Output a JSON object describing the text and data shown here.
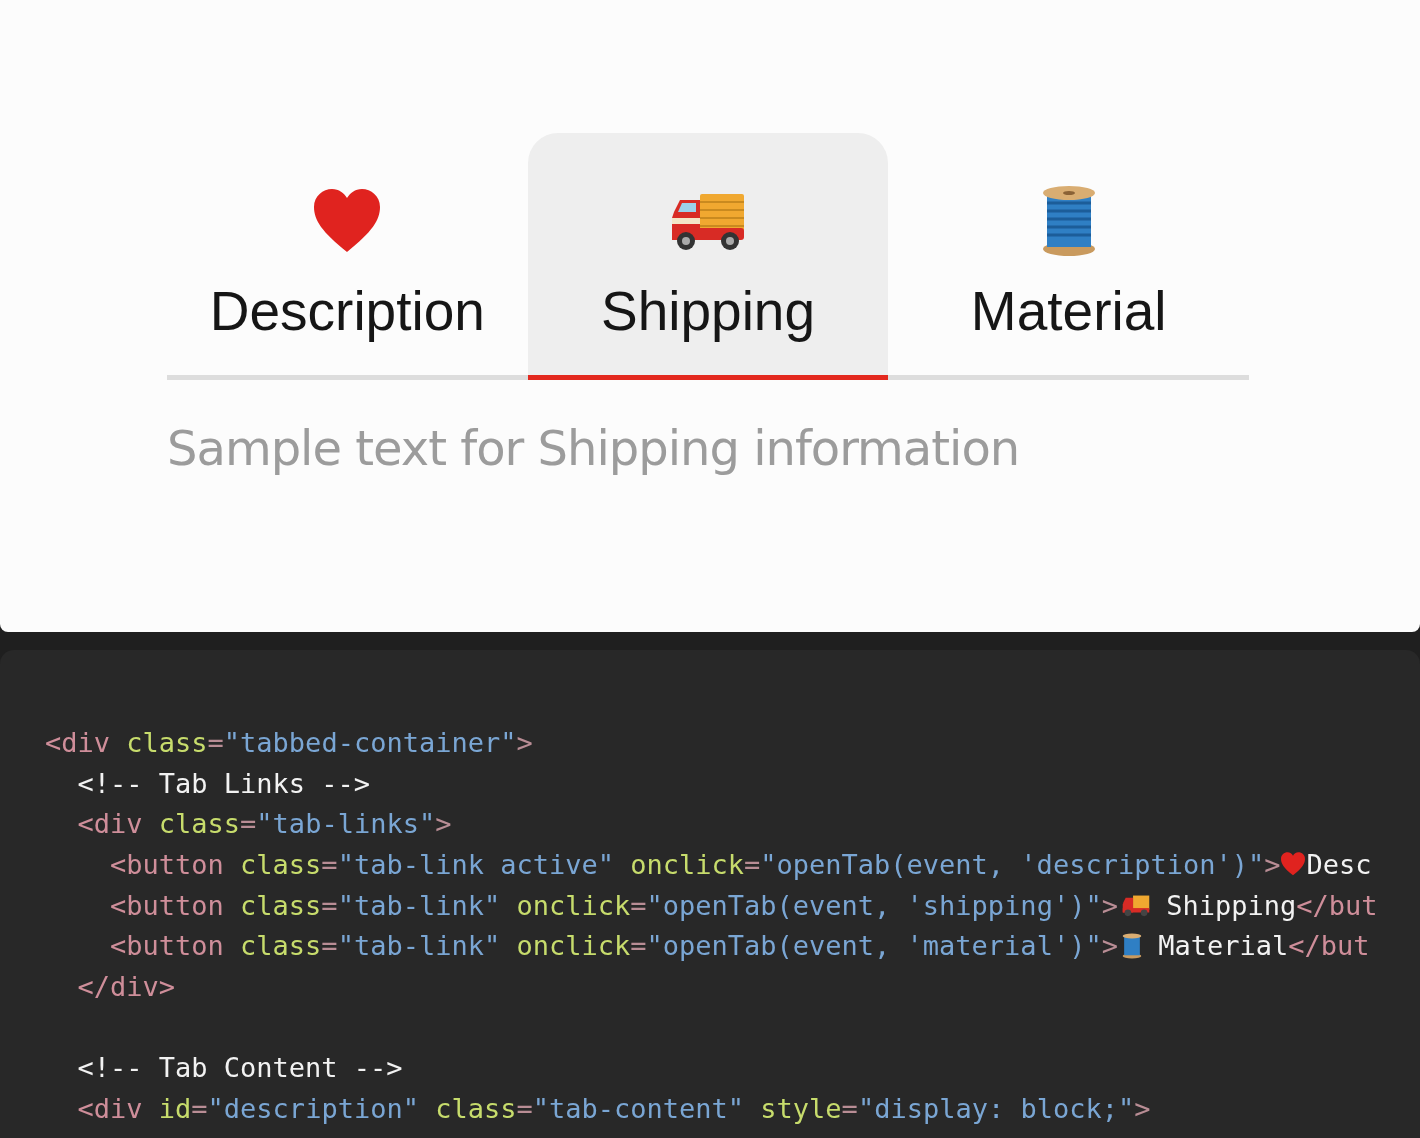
{
  "tabs": [
    {
      "label": "Description",
      "selected": false
    },
    {
      "label": "Shipping",
      "selected": true
    },
    {
      "label": "Material",
      "selected": false
    }
  ],
  "tab_content": "Sample text for Shipping information",
  "code": {
    "blocks": [
      {
        "lines": [
          {
            "segments": [
              {
                "kind": "tag",
                "text": "<div"
              },
              {
                "kind": "attr",
                "text": " class"
              },
              {
                "kind": "punct",
                "text": "="
              },
              {
                "kind": "string",
                "text": "\"tabbed-container\""
              },
              {
                "kind": "punct",
                "text": ">"
              }
            ]
          },
          {
            "segments": [
              {
                "kind": "plain",
                "text": "  <!-- Tab Links -->"
              }
            ]
          },
          {
            "segments": [
              {
                "kind": "tag",
                "text": "  <div"
              },
              {
                "kind": "attr",
                "text": " class"
              },
              {
                "kind": "punct",
                "text": "="
              },
              {
                "kind": "string",
                "text": "\"tab-links\""
              },
              {
                "kind": "punct",
                "text": ">"
              }
            ]
          },
          {
            "segments": [
              {
                "kind": "tag",
                "text": "    <button"
              },
              {
                "kind": "attr",
                "text": " class"
              },
              {
                "kind": "punct",
                "text": "="
              },
              {
                "kind": "string",
                "text": "\"tab-link active\""
              },
              {
                "kind": "attr",
                "text": " onclick"
              },
              {
                "kind": "punct",
                "text": "="
              },
              {
                "kind": "string",
                "text": "\"openTab(event, 'description')\""
              },
              {
                "kind": "punct",
                "text": ">"
              },
              {
                "kind": "emoji"
              },
              {
                "kind": "plain",
                "text": "Desc"
              }
            ]
          },
          {
            "segments": [
              {
                "kind": "tag",
                "text": "    <button"
              },
              {
                "kind": "attr",
                "text": " class"
              },
              {
                "kind": "punct",
                "text": "="
              },
              {
                "kind": "string",
                "text": "\"tab-link\""
              },
              {
                "kind": "attr",
                "text": " onclick"
              },
              {
                "kind": "punct",
                "text": "="
              },
              {
                "kind": "string",
                "text": "\"openTab(event, 'shipping')\""
              },
              {
                "kind": "punct",
                "text": ">"
              },
              {
                "kind": "emoji"
              },
              {
                "kind": "plain",
                "text": " Shipping"
              },
              {
                "kind": "tag",
                "text": "</but"
              }
            ]
          },
          {
            "segments": [
              {
                "kind": "tag",
                "text": "    <button"
              },
              {
                "kind": "attr",
                "text": " class"
              },
              {
                "kind": "punct",
                "text": "="
              },
              {
                "kind": "string",
                "text": "\"tab-link\""
              },
              {
                "kind": "attr",
                "text": " onclick"
              },
              {
                "kind": "punct",
                "text": "="
              },
              {
                "kind": "string",
                "text": "\"openTab(event, 'material')\""
              },
              {
                "kind": "punct",
                "text": ">"
              },
              {
                "kind": "emoji"
              },
              {
                "kind": "plain",
                "text": " Material"
              },
              {
                "kind": "tag",
                "text": "</but"
              }
            ]
          },
          {
            "segments": [
              {
                "kind": "tag",
                "text": "  </div>"
              }
            ]
          }
        ]
      },
      {
        "lines": [
          {
            "segments": [
              {
                "kind": "plain",
                "text": "  <!-- Tab Content -->"
              }
            ]
          },
          {
            "segments": [
              {
                "kind": "tag",
                "text": "  <div"
              },
              {
                "kind": "attr",
                "text": " id"
              },
              {
                "kind": "punct",
                "text": "="
              },
              {
                "kind": "string",
                "text": "\"description\""
              },
              {
                "kind": "attr",
                "text": " class"
              },
              {
                "kind": "punct",
                "text": "="
              },
              {
                "kind": "string",
                "text": "\"tab-content\""
              },
              {
                "kind": "attr",
                "text": " style"
              },
              {
                "kind": "punct",
                "text": "="
              },
              {
                "kind": "string",
                "text": "\"display: block;\""
              },
              {
                "kind": "punct",
                "text": ">"
              }
            ]
          }
        ]
      }
    ]
  }
}
